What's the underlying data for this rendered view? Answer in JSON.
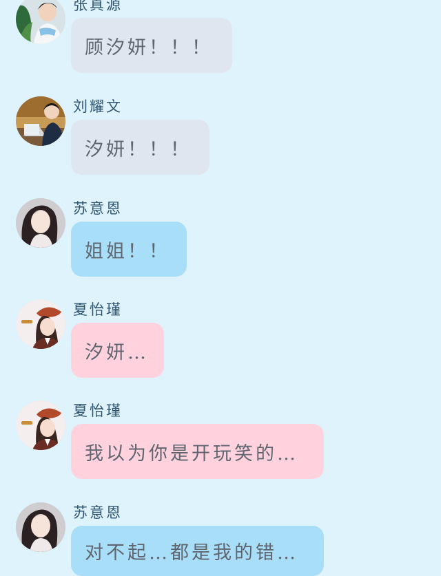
{
  "messages": [
    {
      "sender": "张真源",
      "text": "顾汐妍！！！",
      "bubble": "grey",
      "avatar": "avatar-zhang"
    },
    {
      "sender": "刘耀文",
      "text": "汐妍！！！",
      "bubble": "grey",
      "avatar": "avatar-liu"
    },
    {
      "sender": "苏意恩",
      "text": "姐姐！！",
      "bubble": "blue",
      "avatar": "avatar-su"
    },
    {
      "sender": "夏怡瑾",
      "text": "汐妍…",
      "bubble": "pink",
      "avatar": "avatar-xia"
    },
    {
      "sender": "夏怡瑾",
      "text": "我以为你是开玩笑的…",
      "bubble": "pink",
      "avatar": "avatar-xia"
    },
    {
      "sender": "苏意恩",
      "text": "对不起…都是我的错…",
      "bubble": "blue",
      "avatar": "avatar-su"
    }
  ],
  "colors": {
    "background": "#dff3fd",
    "bubble_grey": "#dfe6ef",
    "bubble_blue": "#a9def8",
    "bubble_pink": "#ffd2de",
    "name_text": "#2f5571",
    "message_text": "#5f6670"
  }
}
